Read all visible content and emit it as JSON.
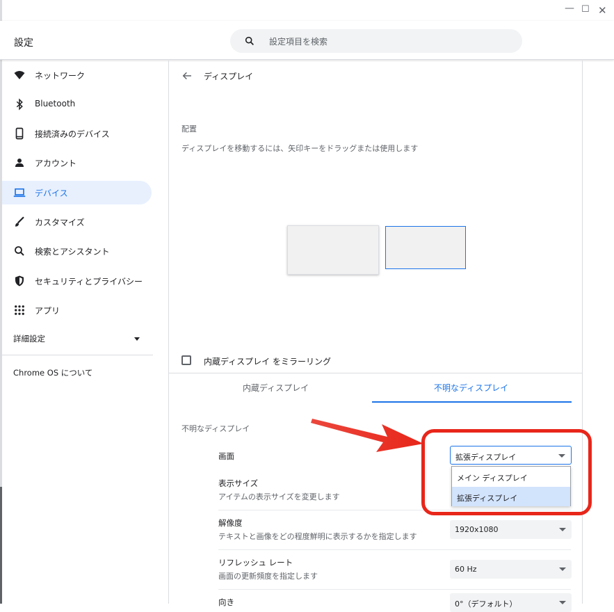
{
  "app": {
    "title": "設定"
  },
  "window_controls": {
    "minimize": "—",
    "maximize": "☐",
    "close": "✕"
  },
  "search": {
    "placeholder": "設定項目を検索"
  },
  "sidebar": {
    "items": [
      {
        "label": "ネットワーク",
        "icon": "wifi-icon",
        "active": false
      },
      {
        "label": "Bluetooth",
        "icon": "bluetooth-icon",
        "active": false
      },
      {
        "label": "接続済みのデバイス",
        "icon": "phone-icon",
        "active": false
      },
      {
        "label": "アカウント",
        "icon": "person-icon",
        "active": false
      },
      {
        "label": "デバイス",
        "icon": "laptop-icon",
        "active": true
      },
      {
        "label": "カスタマイズ",
        "icon": "brush-icon",
        "active": false
      },
      {
        "label": "検索とアシスタント",
        "icon": "search-icon",
        "active": false
      },
      {
        "label": "セキュリティとプライバシー",
        "icon": "shield-icon",
        "active": false
      },
      {
        "label": "アプリ",
        "icon": "apps-grid-icon",
        "active": false
      }
    ],
    "advanced_label": "詳細設定",
    "about_label": "Chrome OS について"
  },
  "main": {
    "page_title": "ディスプレイ",
    "arrangement_label": "配置",
    "arrangement_desc": "ディスプレイを移動するには、矢印キーをドラッグまたは使用します",
    "mirror_label": "内蔵ディスプレイ をミラーリング",
    "mirror_checked": false,
    "tabs": [
      {
        "label": "内蔵ディスプレイ",
        "active": false
      },
      {
        "label": "不明なディスプレイ",
        "active": true
      }
    ],
    "display_section_title": "不明なディスプレイ",
    "rows": {
      "screen": {
        "label": "画面",
        "value": "拡張ディスプレイ"
      },
      "display_size": {
        "label": "表示サイズ",
        "sub": "アイテムの表示サイズを変更します"
      },
      "resolution": {
        "label": "解像度",
        "sub": "テキストと画像をどの程度鮮明に表示するかを指定します",
        "value": "1920x1080"
      },
      "refresh": {
        "label": "リフレッシュ レート",
        "sub": "画面の更新頻度を指定します",
        "value": "60 Hz"
      },
      "orientation": {
        "label": "向き",
        "value": "0°（デフォルト）"
      }
    },
    "dropdown_options": [
      {
        "label": "メイン ディスプレイ",
        "selected": false
      },
      {
        "label": "拡張ディスプレイ",
        "selected": true
      }
    ]
  },
  "colors": {
    "accent": "#1a73e8",
    "active_nav_bg": "#e8f0fe",
    "annotation_red": "#e8261a"
  }
}
